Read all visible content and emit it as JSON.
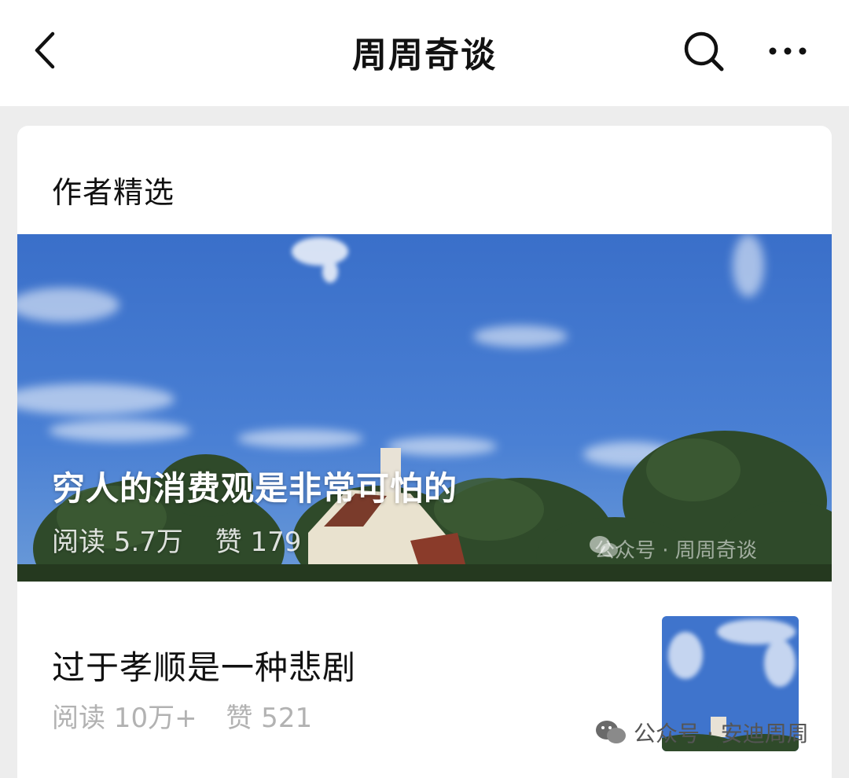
{
  "header": {
    "title": "周周奇谈",
    "back_icon": "chevron-left-icon",
    "search_icon": "search-icon",
    "more_icon": "more-horizontal-icon"
  },
  "section": {
    "title": "作者精选"
  },
  "featured": {
    "title": "穷人的消费观是非常可怕的",
    "reads": "阅读 5.7万",
    "likes": "赞 179",
    "watermark": "公众号 · 周周奇谈"
  },
  "articles": [
    {
      "title": "过于孝顺是一种悲剧",
      "reads": "阅读 10万+",
      "likes": "赞 521"
    }
  ],
  "footer_watermark": "公众号 · 安迪周周",
  "colors": {
    "sky": "#3d74cc",
    "page_bg": "#ededed",
    "muted_text": "#b2b2b2"
  }
}
